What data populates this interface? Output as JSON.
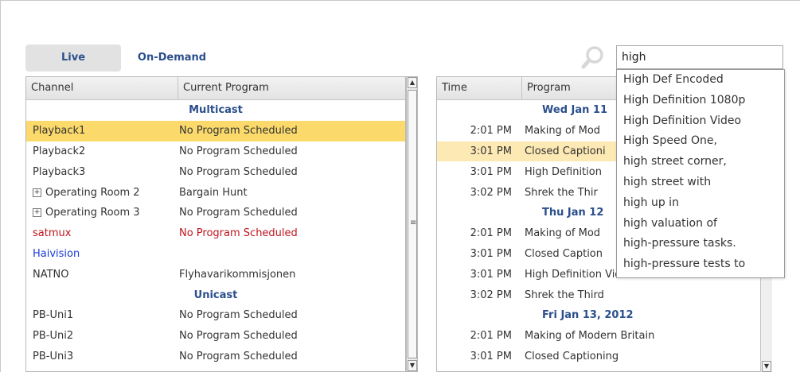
{
  "tabs": {
    "live": "Live",
    "on_demand": "On-Demand"
  },
  "search": {
    "value": "high"
  },
  "channels_table": {
    "headers": {
      "channel": "Channel",
      "current_program": "Current Program"
    },
    "rows": [
      {
        "type": "group",
        "label": "Multicast"
      },
      {
        "channel": "Playback1",
        "program": "No Program Scheduled",
        "selected": true
      },
      {
        "channel": "Playback2",
        "program": "No Program Scheduled"
      },
      {
        "channel": "Playback3",
        "program": "No Program Scheduled"
      },
      {
        "channel": "Operating Room 2",
        "program": "Bargain Hunt",
        "expandable": true
      },
      {
        "channel": "Operating Room 3",
        "program": "No Program Scheduled",
        "expandable": true
      },
      {
        "channel": "satmux",
        "program": "No Program Scheduled",
        "color": "red"
      },
      {
        "channel": "Haivision",
        "program": "",
        "color": "blue"
      },
      {
        "channel": "NATNO",
        "program": "Flyhavarikommisjonen"
      },
      {
        "type": "group",
        "label": "Unicast"
      },
      {
        "channel": "PB-Uni1",
        "program": "No Program Scheduled"
      },
      {
        "channel": "PB-Uni2",
        "program": "No Program Scheduled"
      },
      {
        "channel": "PB-Uni3",
        "program": "No Program Scheduled"
      }
    ]
  },
  "schedule_table": {
    "headers": {
      "time": "Time",
      "program": "Program"
    },
    "rows": [
      {
        "type": "group",
        "label": "Wed Jan 11"
      },
      {
        "time": "2:01 PM",
        "program": "Making of Mod"
      },
      {
        "time": "3:01 PM",
        "program": "Closed Captioni",
        "selected": true
      },
      {
        "time": "3:01 PM",
        "program": "High Definition"
      },
      {
        "time": "3:02 PM",
        "program": "Shrek the Thir"
      },
      {
        "type": "group",
        "label": "Thu Jan 12"
      },
      {
        "time": "2:01 PM",
        "program": "Making of Mod"
      },
      {
        "time": "3:01 PM",
        "program": "Closed Caption"
      },
      {
        "time": "3:01 PM",
        "program": "High Definition Video"
      },
      {
        "time": "3:02 PM",
        "program": "Shrek the Third"
      },
      {
        "type": "group",
        "label": "Fri Jan 13, 2012"
      },
      {
        "time": "2:01 PM",
        "program": "Making of Modern Britain"
      },
      {
        "time": "3:01 PM",
        "program": "Closed Captioning"
      }
    ]
  },
  "suggestions": [
    "High Def Encoded",
    "High Definition 1080p",
    "High Definition Video",
    "High Speed One,",
    "high street corner,",
    "high street with",
    "high up in",
    "high valuation of",
    "high-pressure tasks.",
    "high-pressure tests to"
  ],
  "colors": {
    "accent": "#2b4f8c",
    "selected": "#fbd96b",
    "selected_light": "#fce9b4",
    "red": "#c0151c",
    "blue": "#1a3ad8"
  },
  "icons": {
    "search": "search-icon",
    "expand": "expand-icon",
    "scroll_up": "arrow-up-icon",
    "scroll_down": "arrow-down-icon"
  }
}
